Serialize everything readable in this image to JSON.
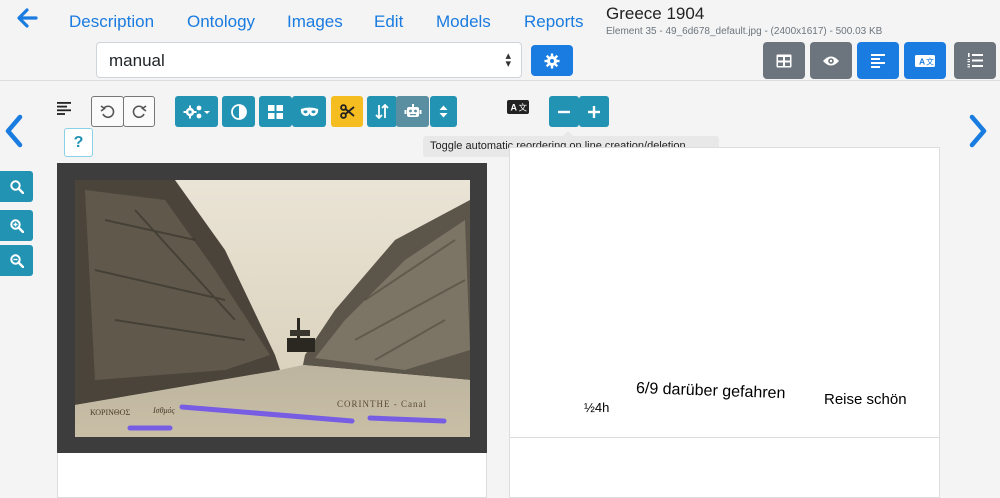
{
  "nav": {
    "items": [
      "Description",
      "Ontology",
      "Images",
      "Edit",
      "Models",
      "Reports"
    ]
  },
  "document": {
    "title": "Greece 1904",
    "subtitle": "Element 35 - 49_6d678_default.jpg - (2400x1617) - 500.03 KB"
  },
  "model_select": {
    "value": "manual"
  },
  "tooltip": "Toggle automatic reordering on line creation/deletion.",
  "help": "?",
  "postcard": {
    "left_caption": "ΚΟΡΙΝΘΟΣ",
    "mid_caption": "Ισθμός",
    "right_caption": "CORINTHE - Canal"
  },
  "transcription": {
    "line1": "6/9 darüber gefahren",
    "line2": "Reise schön",
    "line3": "½4h"
  },
  "colors": {
    "primary": "#1a7be0",
    "teal": "#2293b3",
    "gray": "#6c757d",
    "warning": "#f5bd1f",
    "highlight": "#6a4cf0"
  },
  "icons": [
    "arrow-left-icon",
    "gear-icon",
    "table-icon",
    "eye-icon",
    "align-left-icon",
    "translate-icon",
    "list-ol-icon",
    "undo-icon",
    "redo-icon",
    "settings-icon",
    "contrast-icon",
    "grid-icon",
    "mask-icon",
    "scissors-icon",
    "sort-icon",
    "robot-icon",
    "updown-icon",
    "minus-icon",
    "plus-icon",
    "search-icon",
    "zoom-in-icon",
    "zoom-out-icon",
    "chevron-left-icon",
    "chevron-right-icon"
  ]
}
